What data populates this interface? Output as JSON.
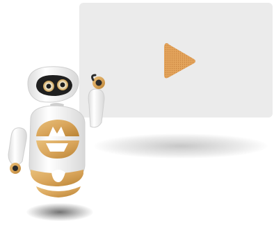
{
  "colors": {
    "card": "#ebebeb",
    "play": "#e0a15a",
    "play_dot": "#c9833f",
    "gold": "#d9a55b",
    "gold_dark": "#b98334",
    "robot_white": "#f4f4f4",
    "visor": "#1f1f1f"
  },
  "icons": {
    "play": "play-triangle-icon",
    "robot": "robot-mascot-illustration"
  }
}
